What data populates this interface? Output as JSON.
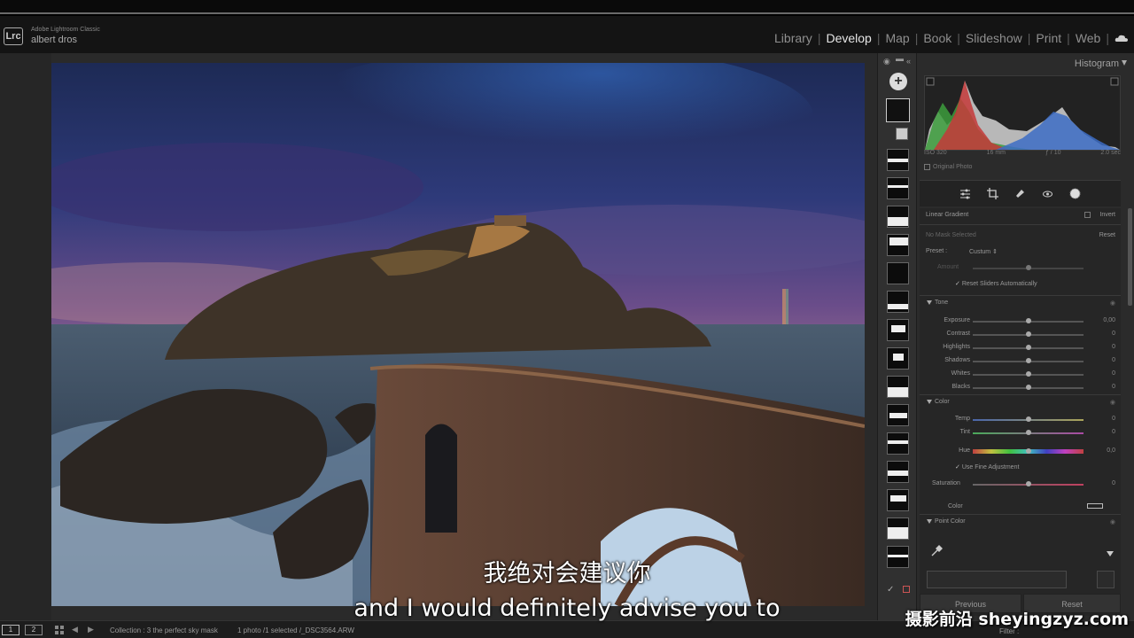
{
  "app": {
    "name": "Adobe Lightroom Classic",
    "logo": "Lrc",
    "user": "albert dros"
  },
  "modules": [
    "Library",
    "Develop",
    "Map",
    "Book",
    "Slideshow",
    "Print",
    "Web"
  ],
  "active_module": "Develop",
  "histogram": {
    "title": "Histogram",
    "iso": "ISO 320",
    "focal": "16 mm",
    "aperture": "ƒ / 10",
    "shutter": "2.0 sec",
    "original_photo": "Original Photo"
  },
  "mask": {
    "type": "Linear Gradient",
    "invert": "Invert",
    "status": "No Mask Selected",
    "reset": "Reset",
    "preset_label": "Preset :",
    "preset_value": "Custum",
    "amount_label": "Amount",
    "reset_sliders": "Reset Sliders Automatically"
  },
  "tone": {
    "title": "Tone",
    "sliders": [
      {
        "label": "Exposure",
        "value": "0,00",
        "pos": 0.5
      },
      {
        "label": "Contrast",
        "value": "0",
        "pos": 0.5
      },
      {
        "label": "Highlights",
        "value": "0",
        "pos": 0.5
      },
      {
        "label": "Shadows",
        "value": "0",
        "pos": 0.5
      },
      {
        "label": "Whites",
        "value": "0",
        "pos": 0.5
      },
      {
        "label": "Blacks",
        "value": "0",
        "pos": 0.5
      }
    ]
  },
  "color": {
    "title": "Color",
    "temp": {
      "label": "Temp",
      "value": "0"
    },
    "tint": {
      "label": "Tint",
      "value": "0"
    },
    "hue": {
      "label": "Hue",
      "value": "0,0"
    },
    "fine_adjust": "Use Fine Adjustment",
    "saturation": {
      "label": "Saturation",
      "value": "0"
    },
    "color_label": "Color"
  },
  "point_color": {
    "title": "Point Color"
  },
  "buttons": {
    "previous": "Previous",
    "reset": "Reset"
  },
  "filmstrip": {
    "page1": "1",
    "page2": "2",
    "collection": "Collection : 3 the perfect sky mask",
    "selection": "1 photo /1 selected /_DSC3564.ARW",
    "filter": "Filter :"
  },
  "subtitle": {
    "zh": "我绝对会建议你",
    "en": "and I would definitely advise you to"
  },
  "watermark": "摄影前沿 sheyingzyz.com",
  "icons": [
    "cloud-icon",
    "add-mask-icon",
    "eye-icon",
    "grid-icon",
    "eyedropper-icon",
    "histogram-arrow-icon"
  ]
}
